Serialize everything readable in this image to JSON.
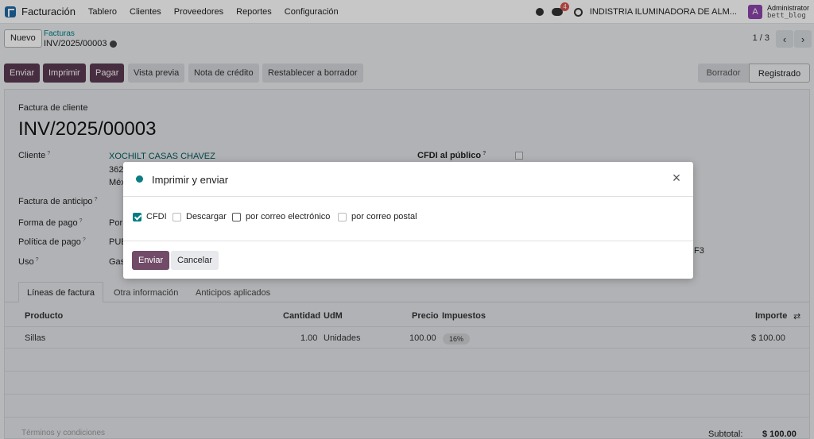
{
  "navbar": {
    "app_name": "Facturación",
    "menu": [
      "Tablero",
      "Clientes",
      "Proveedores",
      "Reportes",
      "Configuración"
    ],
    "chat_badge": "4",
    "company": "INDISTRIA ILUMINADORA DE ALM...",
    "avatar_letter": "A",
    "user_name": "Administrator",
    "user_db": "bett_blog"
  },
  "control": {
    "new_button": "Nuevo",
    "breadcrumb_parent": "Facturas",
    "breadcrumb_current": "INV/2025/00003",
    "pager": "1 / 3",
    "prev": "‹",
    "next": "›"
  },
  "actions": {
    "buttons": [
      "Enviar",
      "Imprimir",
      "Pagar",
      "Vista previa",
      "Nota de crédito",
      "Restablecer a borrador"
    ],
    "status": [
      "Borrador",
      "Registrado"
    ],
    "active_status": "Registrado"
  },
  "sheet": {
    "doc_type": "Factura de cliente",
    "doc_number": "INV/2025/00003",
    "cliente_label": "Cliente",
    "cliente_value": "XOCHILT CASAS CHAVEZ",
    "cliente_addr1": "362",
    "cliente_addr2": "Méx",
    "cfdi_publico_label": "CFDI al público",
    "factura_anticipo_label": "Factura de anticipo",
    "forma_pago_label": "Forma de pago",
    "forma_pago_value": "Por",
    "politica_pago_label": "Política de pago",
    "politica_pago_value": "PUE",
    "uso_label": "Uso",
    "uso_value": "Gas",
    "right_partial": "F3",
    "tabs": [
      "Líneas de factura",
      "Otra información",
      "Anticipos aplicados"
    ],
    "columns": {
      "producto": "Producto",
      "cantidad": "Cantidad",
      "udm": "UdM",
      "precio": "Precio",
      "impuestos": "Impuestos",
      "importe": "Importe"
    },
    "line": {
      "producto": "Sillas",
      "cantidad": "1.00",
      "udm": "Unidades",
      "precio": "100.00",
      "impuesto": "16%",
      "importe": "$ 100.00"
    },
    "terms_placeholder": "Términos y condiciones",
    "subtotal_label": "Subtotal:",
    "subtotal_value": "$ 100.00"
  },
  "modal": {
    "title": "Imprimir y enviar",
    "options": [
      {
        "label": "CFDI",
        "checked": true
      },
      {
        "label": "Descargar",
        "checked": false
      },
      {
        "label": "por correo electrónico",
        "checked": false
      },
      {
        "label": "por correo postal",
        "checked": false
      }
    ],
    "send_button": "Enviar",
    "cancel_button": "Cancelar"
  },
  "colors": {
    "primary": "#714b67",
    "teal": "#017e84"
  }
}
